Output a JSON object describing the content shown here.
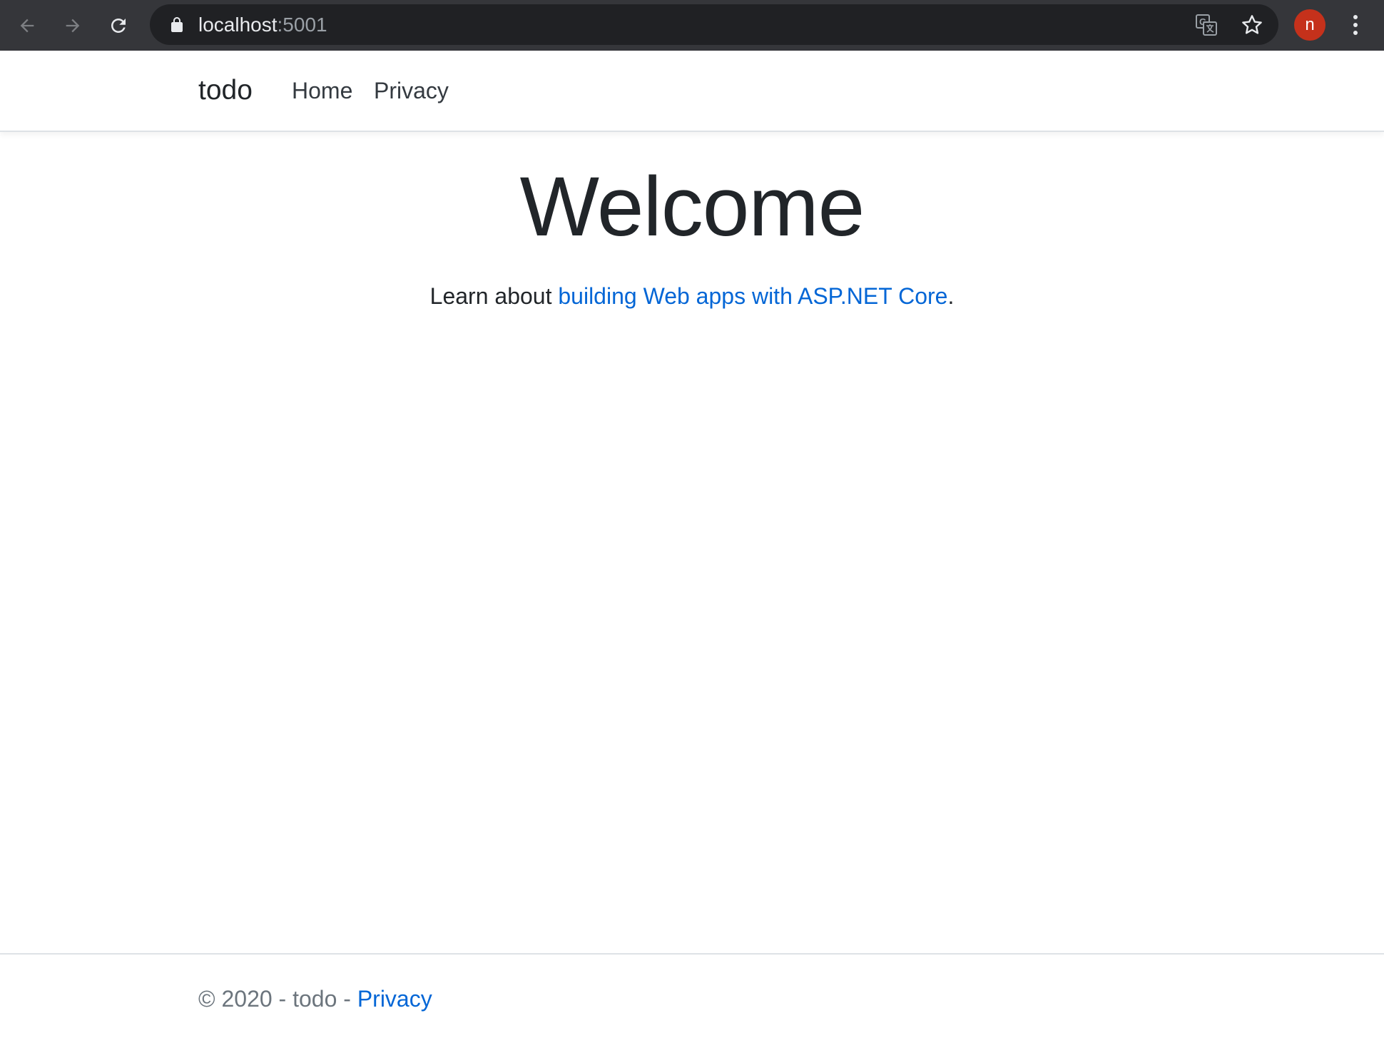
{
  "browser": {
    "url_host": "localhost",
    "url_port": ":5001",
    "profile_initial": "n",
    "icons": {
      "back": "arrow-left-icon",
      "forward": "arrow-right-icon",
      "reload": "reload-icon",
      "lock": "lock-icon",
      "translate": "translate-icon",
      "bookmark": "star-icon",
      "menu": "kebab-menu-icon"
    },
    "colors": {
      "chrome": "#35363a",
      "omnibox": "#202124",
      "avatar": "#c5311b"
    }
  },
  "navbar": {
    "brand": "todo",
    "links": [
      {
        "label": "Home"
      },
      {
        "label": "Privacy"
      }
    ]
  },
  "main": {
    "title": "Welcome",
    "lead_prefix": "Learn about ",
    "lead_link": "building Web apps with ASP.NET Core",
    "lead_suffix": ".",
    "link_color": "#0366d6"
  },
  "footer": {
    "copyright": "© 2020 - todo - ",
    "privacy_link": "Privacy"
  }
}
